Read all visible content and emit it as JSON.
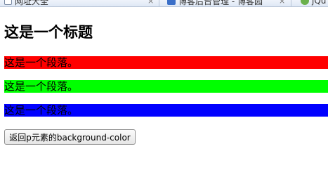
{
  "browser": {
    "tabs": [
      {
        "label": "网址大全",
        "icon": "home-icon"
      },
      {
        "label": "博客后台管理 - 博客园",
        "icon": "site-icon"
      },
      {
        "label": "jQu",
        "icon": "site-icon"
      }
    ],
    "close_glyph": "×"
  },
  "page": {
    "heading": "这是一个标题",
    "paragraphs": [
      {
        "text": "这是一个段落。",
        "background": "#ff0000"
      },
      {
        "text": "这是一个段落。",
        "background": "#00ff00"
      },
      {
        "text": "这是一个段落。",
        "background": "#0000ff"
      }
    ],
    "button_label": "返回p元素的background-color"
  }
}
